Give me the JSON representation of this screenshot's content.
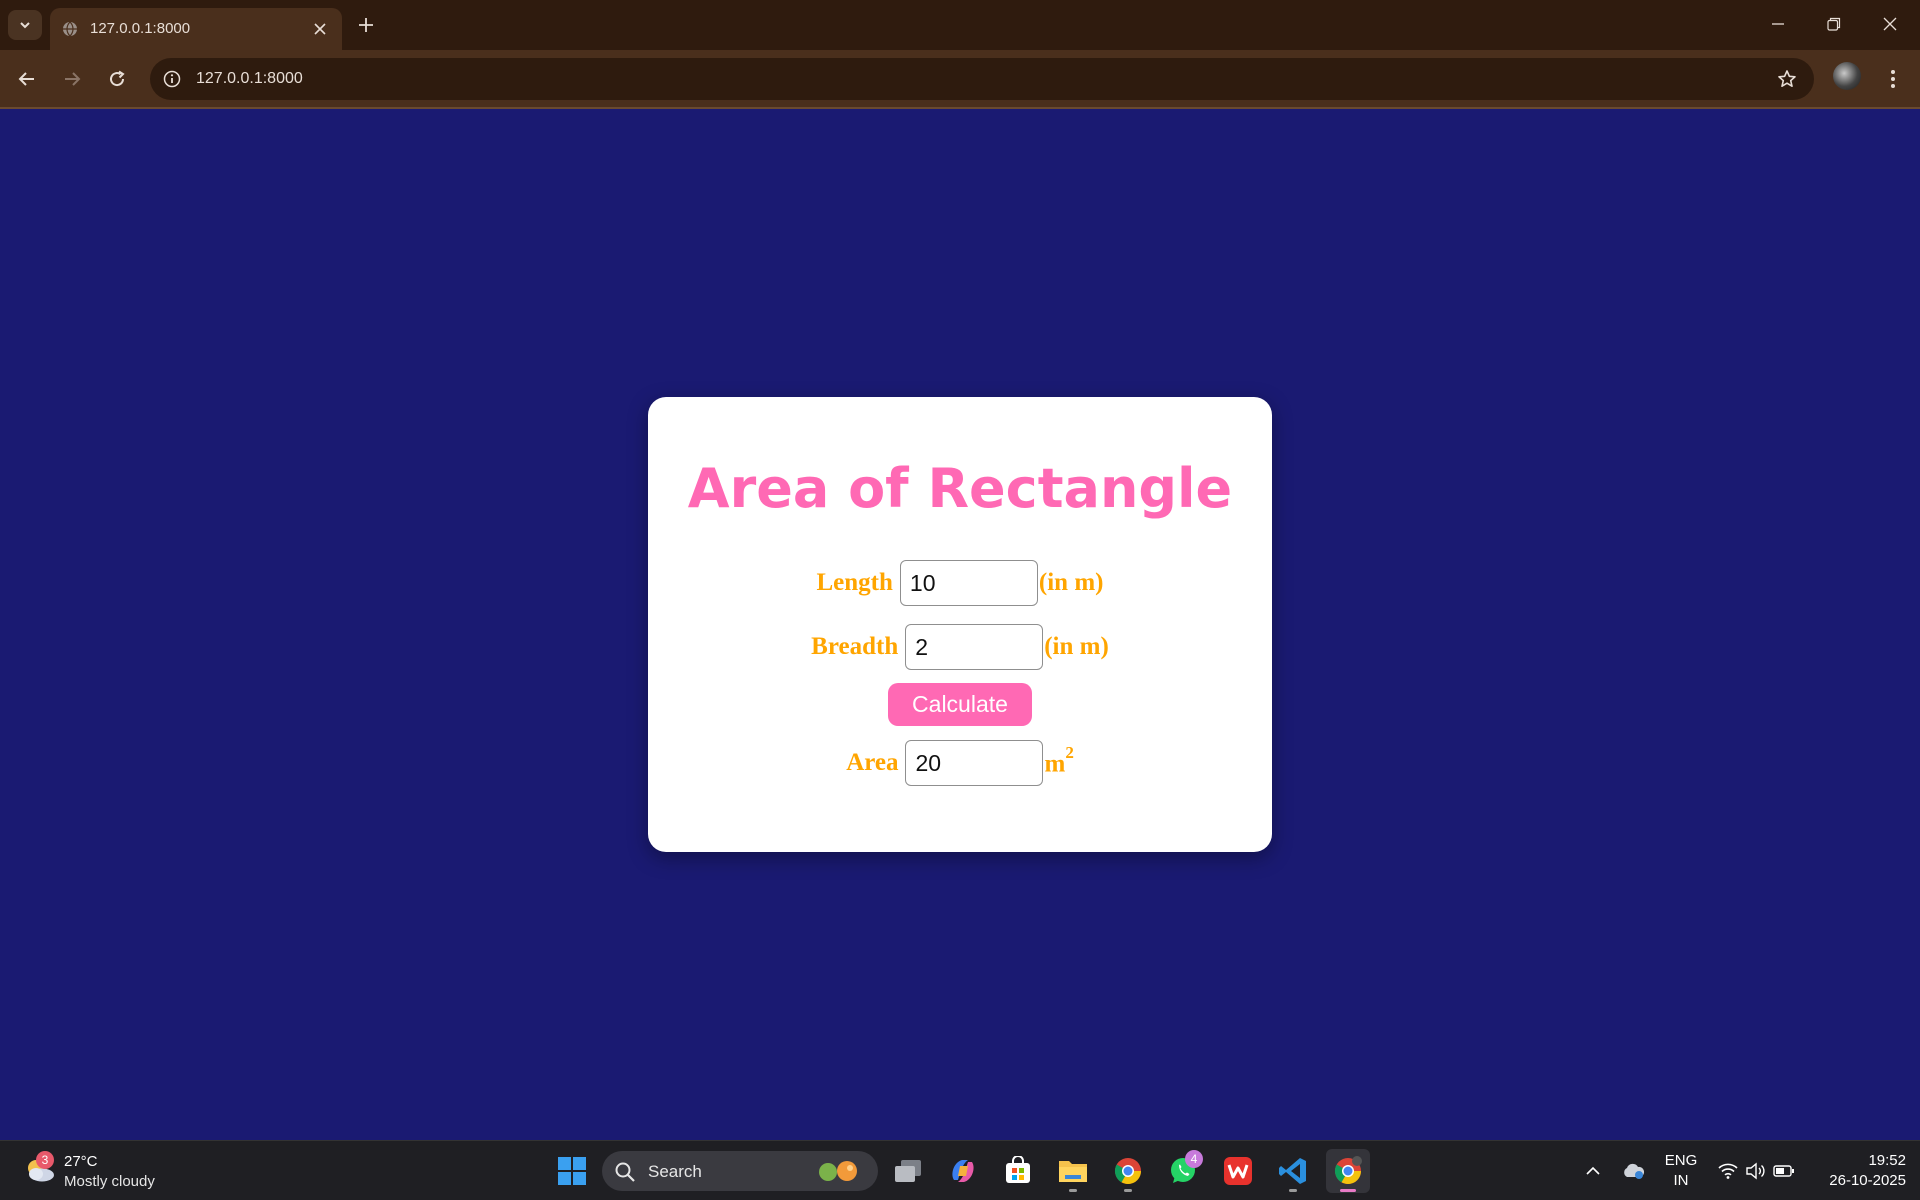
{
  "browser": {
    "tab_title": "127.0.0.1:8000",
    "url": "127.0.0.1:8000"
  },
  "page": {
    "title": "Area of Rectangle",
    "length": {
      "label": "Length",
      "value": "10",
      "unit": "(in m)"
    },
    "breadth": {
      "label": "Breadth",
      "value": "2",
      "unit": "(in m)"
    },
    "calculate_label": "Calculate",
    "area": {
      "label": "Area",
      "value": "20",
      "unit": "m",
      "unit_exponent": "2"
    },
    "colors": {
      "background": "#1a1a72",
      "title": "#ff69b4",
      "labels": "#ffa500",
      "button": "#ff69b4"
    }
  },
  "taskbar": {
    "weather": {
      "temp": "27°C",
      "condition": "Mostly cloudy",
      "badge": "3"
    },
    "search_placeholder": "Search",
    "whatsapp_badge": "4",
    "language": {
      "line1": "ENG",
      "line2": "IN"
    },
    "time": "19:52",
    "date": "26-10-2025"
  }
}
